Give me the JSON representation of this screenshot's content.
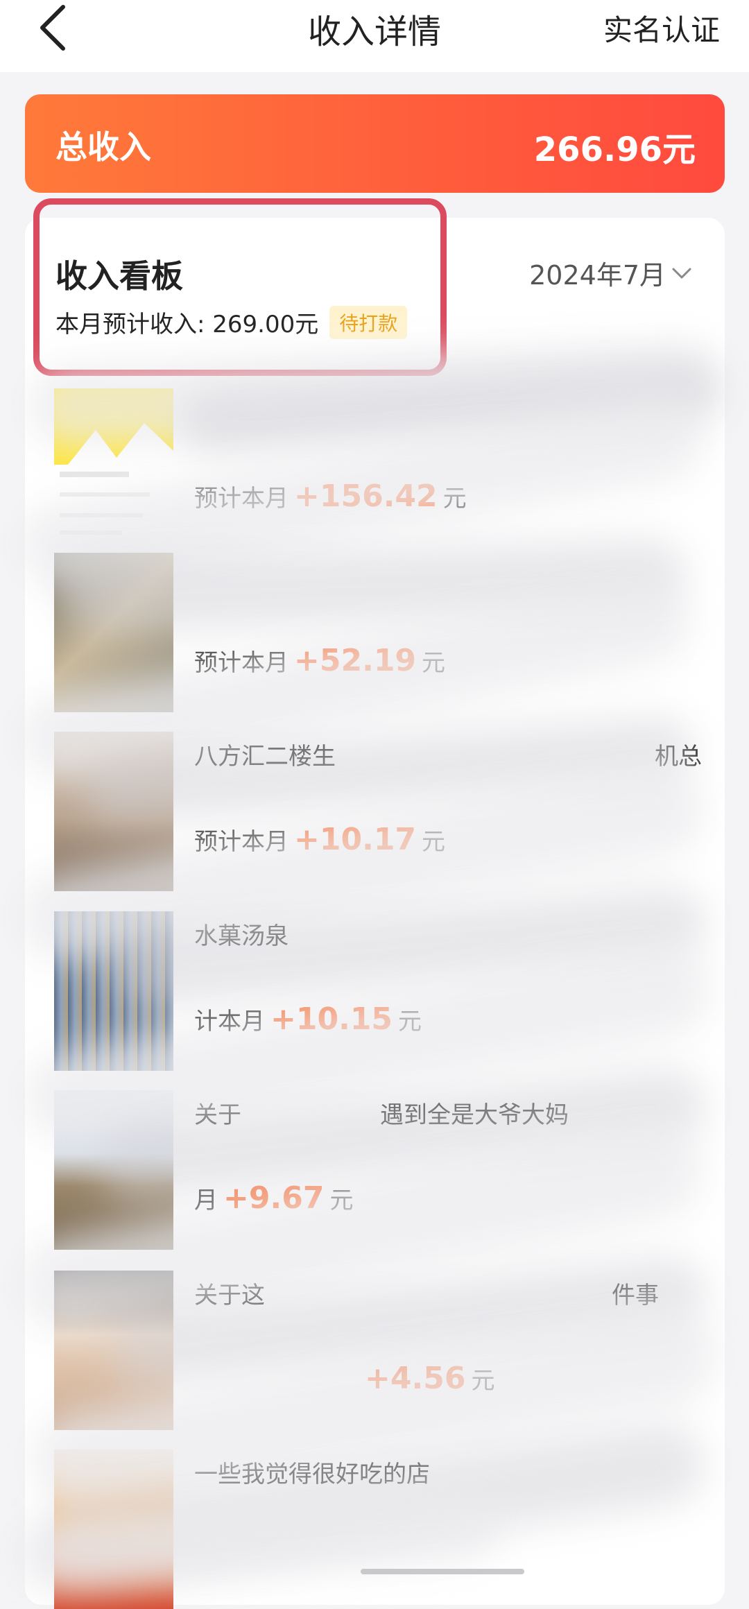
{
  "nav": {
    "title": "收入详情",
    "right_label": "实名认证",
    "back_icon": "chevron-left-icon"
  },
  "summary": {
    "label": "总收入",
    "amount": "266.96元"
  },
  "board": {
    "title": "收入看板",
    "month": "2024年7月",
    "estimate_label": "本月预计收入: 269.00元",
    "status_badge": "待打款"
  },
  "items": [
    {
      "title": "",
      "prefix": "预计本月",
      "amount": "+156.42",
      "unit": "元"
    },
    {
      "title": "",
      "prefix": "预计本月",
      "amount": "+52.19",
      "unit": "元"
    },
    {
      "title": "八方汇二楼生",
      "title_tail": "机总",
      "prefix": "预计本月",
      "amount": "+10.17",
      "unit": "元"
    },
    {
      "title": "水菓汤泉",
      "title_tail": "",
      "prefix": "计本月",
      "amount": "+10.15",
      "unit": "元"
    },
    {
      "title": "关于",
      "title_tail": "遇到全是大爷大妈",
      "prefix": "月",
      "amount": "+9.67",
      "unit": "元"
    },
    {
      "title": "关于这",
      "title_tail": "件事",
      "prefix": "",
      "amount": "+4.56",
      "unit": "元"
    },
    {
      "title": "一些我觉得很好吃的店",
      "title_tail": "",
      "prefix": "",
      "amount": "",
      "unit": ""
    }
  ],
  "colors": {
    "accent": "#ff6a2c",
    "banner_start": "#ff7a3a",
    "banner_end": "#ff4a3e",
    "highlight": "#db4a5e",
    "badge_bg": "#fff3cf",
    "badge_text": "#e8a21a"
  }
}
